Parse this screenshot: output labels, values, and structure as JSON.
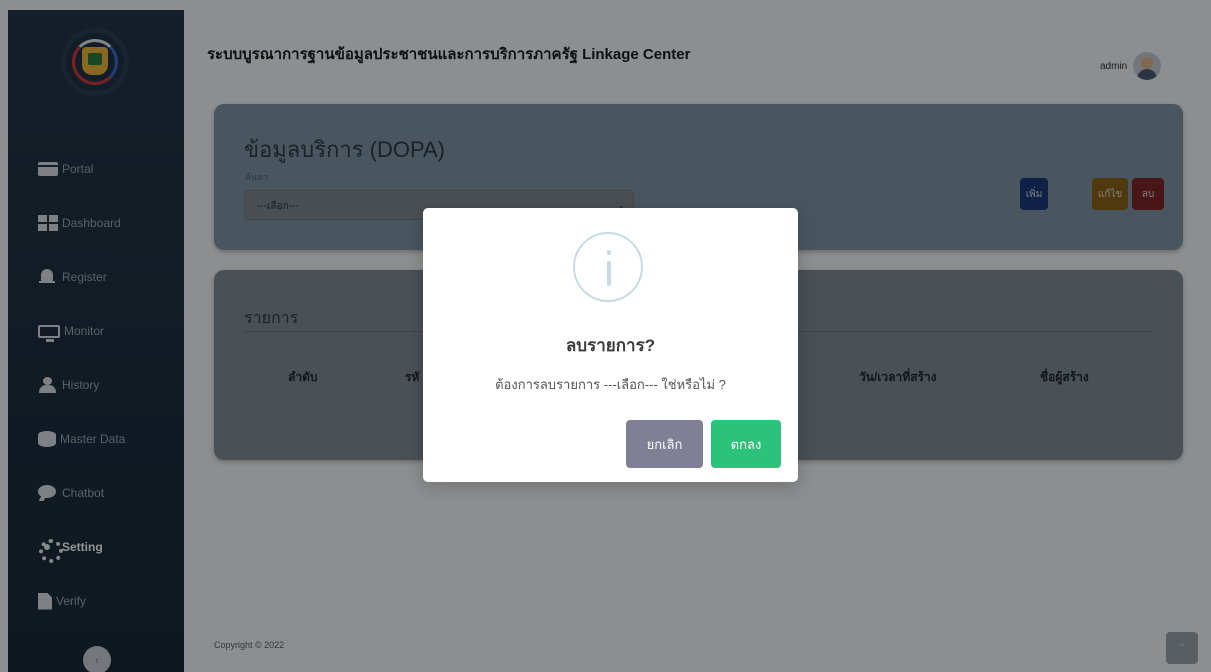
{
  "app": {
    "title": "ระบบบูรณาการฐานข้อมูลประชาชนและการบริการภาครัฐ Linkage Center",
    "user": "admin"
  },
  "sidebar": {
    "items": [
      {
        "label": "Portal",
        "icon": "portal-icon"
      },
      {
        "label": "Dashboard",
        "icon": "dashboard-icon"
      },
      {
        "label": "Register",
        "icon": "bell-icon"
      },
      {
        "label": "Monitor",
        "icon": "monitor-icon"
      },
      {
        "label": "History",
        "icon": "user-icon"
      },
      {
        "label": "Master Data",
        "icon": "database-icon"
      },
      {
        "label": "Chatbot",
        "icon": "chat-icon"
      },
      {
        "label": "Setting",
        "icon": "gear-icon",
        "active": true
      },
      {
        "label": "Verify",
        "icon": "file-icon"
      }
    ],
    "collapse": "‹"
  },
  "service_card": {
    "title": "ข้อมูลบริการ (DOPA)",
    "search_label": "ค้นหา",
    "select_value": "---เลือก---",
    "add_label": "เพิ่ม",
    "edit_label": "แก้ไข",
    "delete_label": "ลบ"
  },
  "list_card": {
    "title": "รายการ",
    "columns": [
      "ลำดับ",
      "รหั",
      "วัน/เวลาที่สร้าง",
      "ชื่อผู้สร้าง"
    ]
  },
  "footer": {
    "copyright": "Copyright © 2022"
  },
  "modal": {
    "icon": "info-icon",
    "title": "ลบรายการ?",
    "message": "ต้องการลบรายการ ---เลือก--- ใช่หรือไม่ ?",
    "cancel_label": "ยกเลิก",
    "ok_label": "ตกลง"
  },
  "colors": {
    "sidebar": "#243647",
    "confirm": "#2bc37a",
    "cancel": "#7f7f95"
  }
}
